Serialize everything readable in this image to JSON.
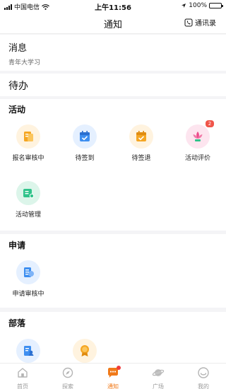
{
  "status_bar": {
    "carrier": "中国电信",
    "time": "上午11:56",
    "battery": "100%"
  },
  "nav": {
    "title": "通知",
    "contacts_label": "通讯录"
  },
  "messages": {
    "title": "消息",
    "subtitle": "青年大学习"
  },
  "todo": {
    "title": "待办"
  },
  "activity": {
    "title": "活动",
    "items": [
      {
        "label": "报名审核中",
        "icon": "document-icon",
        "color": "#f5a623"
      },
      {
        "label": "待签到",
        "icon": "calendar-check-icon",
        "color": "#3d8ef0"
      },
      {
        "label": "待签退",
        "icon": "calendar-check-icon",
        "color": "#f5a623"
      },
      {
        "label": "活动评价",
        "icon": "lotus-icon",
        "color": "#ec4d8c",
        "badge": "2"
      },
      {
        "label": "活动管理",
        "icon": "card-icon",
        "color": "#2fc38a"
      }
    ]
  },
  "application": {
    "title": "申请",
    "items": [
      {
        "label": "申请审核中",
        "icon": "document-icon",
        "color": "#3d8ef0"
      }
    ]
  },
  "tribe": {
    "title": "部落",
    "items": [
      {
        "label": "",
        "icon": "person-document-icon",
        "color": "#3d8ef0"
      },
      {
        "label": "",
        "icon": "medal-icon",
        "color": "#f5a623"
      }
    ]
  },
  "tab_bar": {
    "active": "通知",
    "accent_color": "#f07a1a",
    "tabs": [
      {
        "label": "首页",
        "icon": "home-icon"
      },
      {
        "label": "探索",
        "icon": "compass-icon"
      },
      {
        "label": "通知",
        "icon": "chat-bubble-icon"
      },
      {
        "label": "广场",
        "icon": "planet-icon"
      },
      {
        "label": "我的",
        "icon": "profile-icon"
      }
    ]
  }
}
